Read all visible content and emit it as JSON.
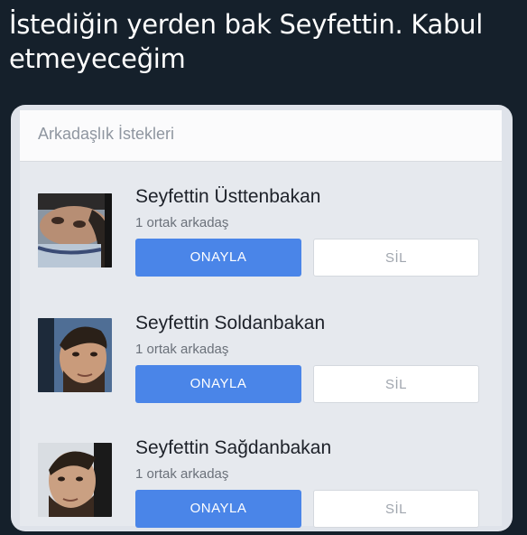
{
  "tweet": {
    "line1": "İstediğin yerden bak Seyfettin. Kabul",
    "line2": "etmeyeceğim"
  },
  "friend_requests": {
    "header": "Arkadaşlık İstekleri",
    "items": [
      {
        "name": "Seyfettin Üsttenbakan",
        "mutual": "1 ortak arkadaş",
        "confirm_label": "ONAYLA",
        "delete_label": "SİL"
      },
      {
        "name": "Seyfettin Soldanbakan",
        "mutual": "1 ortak arkadaş",
        "confirm_label": "ONAYLA",
        "delete_label": "SİL"
      },
      {
        "name": "Seyfettin Sağdanbakan",
        "mutual": "1 ortak arkadaş",
        "confirm_label": "ONAYLA",
        "delete_label": "SİL"
      }
    ]
  },
  "colors": {
    "background": "#15202b",
    "confirm_button": "#4a85e8",
    "card": "#e6e9ee"
  }
}
